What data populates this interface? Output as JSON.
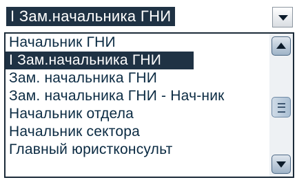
{
  "combo": {
    "selected_value": "I Зам.начальника ГНИ"
  },
  "dropdown": {
    "items": [
      "Начальник ГНИ",
      "I Зам.начальника ГНИ",
      "Зам. начальника ГНИ",
      "Зам. начальника ГНИ - Нач-ник",
      "Начальник отдела",
      "Начальник сектора",
      "Главный юристконсульт"
    ],
    "selected_index": 1
  },
  "icons": {
    "combo_arrow": "chevron-down-icon",
    "scroll_up": "scroll-up-arrow-icon",
    "scroll_thumb": "grip-icon",
    "scroll_down": "scroll-down-arrow-icon"
  },
  "colors": {
    "selection": "#1f3244",
    "item_text": "#0a2a42"
  }
}
